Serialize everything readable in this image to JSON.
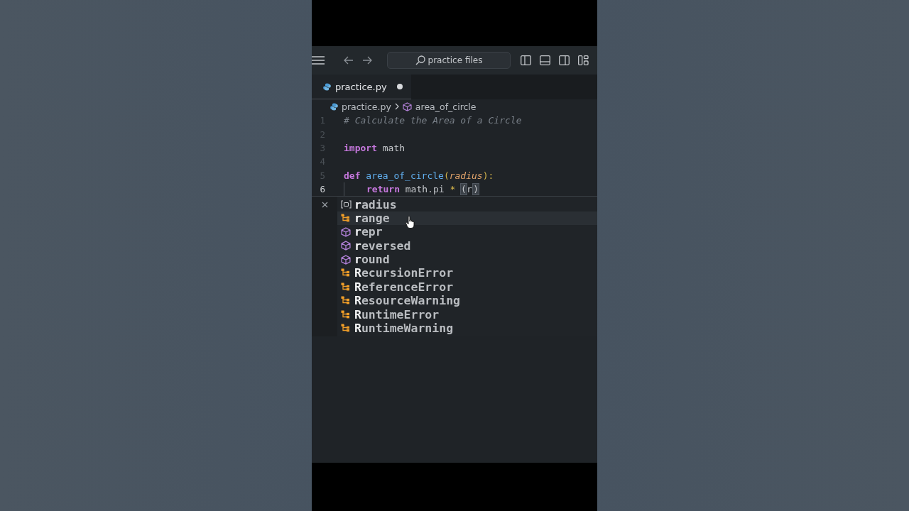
{
  "titlebar": {
    "search": {
      "value": "practice files"
    }
  },
  "tabs": [
    {
      "label": "practice.py",
      "selected": true,
      "modified": true
    }
  ],
  "breadcrumb": {
    "file": "practice.py",
    "symbol": "area_of_circle"
  },
  "editor": {
    "lines": [
      {
        "number": "1",
        "current": false,
        "tokens": [
          {
            "text": "# Calculate the Area of a Circle",
            "kind": "comment"
          }
        ]
      },
      {
        "number": "2",
        "current": false
      },
      {
        "number": "3",
        "current": false,
        "tokens": [
          {
            "text": "import",
            "kind": "keyword"
          },
          {
            "text": " math",
            "kind": "plain"
          }
        ]
      },
      {
        "number": "4",
        "current": false
      },
      {
        "number": "5",
        "current": false,
        "tokens": [
          {
            "text": "def",
            "kind": "keyword"
          },
          {
            "text": " area_of_circle",
            "kind": "function"
          },
          {
            "text": "(",
            "kind": "punct"
          },
          {
            "text": "radius",
            "kind": "param"
          },
          {
            "text": "):",
            "kind": "punct"
          }
        ]
      },
      {
        "number": "6",
        "current": true,
        "indent": true,
        "tokens": [
          {
            "text": "return",
            "kind": "keyword"
          },
          {
            "text": " math.pi ",
            "kind": "plain"
          },
          {
            "text": "* ",
            "kind": "operator"
          },
          {
            "text": "(",
            "kind": "bracket"
          },
          {
            "text": "r",
            "kind": "plain",
            "cursor": true
          },
          {
            "text": ")",
            "kind": "bracket"
          }
        ]
      }
    ]
  },
  "suggestions": [
    {
      "label": "**r**adius",
      "kind": "variable",
      "selected": false
    },
    {
      "label": "**r**ange",
      "kind": "class",
      "selected": true
    },
    {
      "label": "**r**epr",
      "kind": "method",
      "selected": false
    },
    {
      "label": "**r**eversed",
      "kind": "method",
      "selected": false
    },
    {
      "label": "**r**ound",
      "kind": "method",
      "selected": false
    },
    {
      "label": "**R**ecursionError",
      "kind": "class",
      "selected": false
    },
    {
      "label": "**R**eferenceError",
      "kind": "class",
      "selected": false
    },
    {
      "label": "**R**esourceWarning",
      "kind": "class",
      "selected": false
    },
    {
      "label": "**R**untimeError",
      "kind": "class",
      "selected": false
    },
    {
      "label": "**R**untimeWarning",
      "kind": "class",
      "selected": false
    }
  ]
}
